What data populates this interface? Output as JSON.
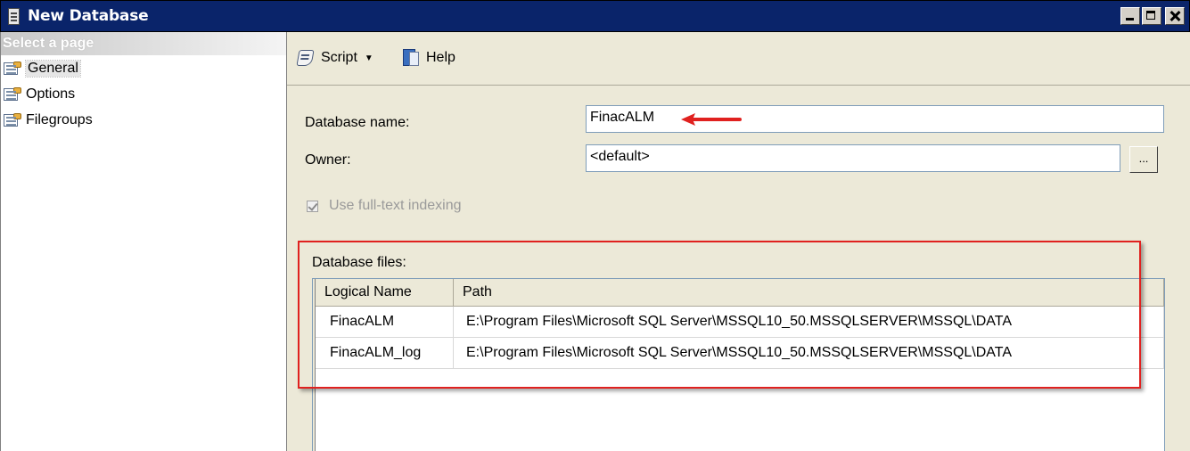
{
  "window": {
    "title": "New Database",
    "colors": {
      "titlebar": "#0a246a",
      "accent_red": "#e0211f"
    }
  },
  "left_panel": {
    "header": "Select a page",
    "pages": [
      {
        "label": "General",
        "icon": "properties-icon",
        "selected": true
      },
      {
        "label": "Options",
        "icon": "properties-icon",
        "selected": false
      },
      {
        "label": "Filegroups",
        "icon": "properties-icon",
        "selected": false
      }
    ]
  },
  "toolbar": {
    "script_label": "Script",
    "help_label": "Help"
  },
  "general": {
    "database_name_label": "Database name:",
    "database_name_value": "FinacALM",
    "owner_label": "Owner:",
    "owner_value": "<default>",
    "browse_label": "...",
    "fulltext_label": "Use full-text indexing",
    "fulltext_checked": true,
    "fulltext_enabled": false
  },
  "database_files": {
    "label": "Database files:",
    "columns": [
      "Logical Name",
      "Path"
    ],
    "rows": [
      {
        "logical_name": "FinacALM",
        "path": "E:\\Program Files\\Microsoft SQL Server\\MSSQL10_50.MSSQLSERVER\\MSSQL\\DATA"
      },
      {
        "logical_name": "FinacALM_log",
        "path": "E:\\Program Files\\Microsoft SQL Server\\MSSQL10_50.MSSQLSERVER\\MSSQL\\DATA"
      }
    ]
  }
}
